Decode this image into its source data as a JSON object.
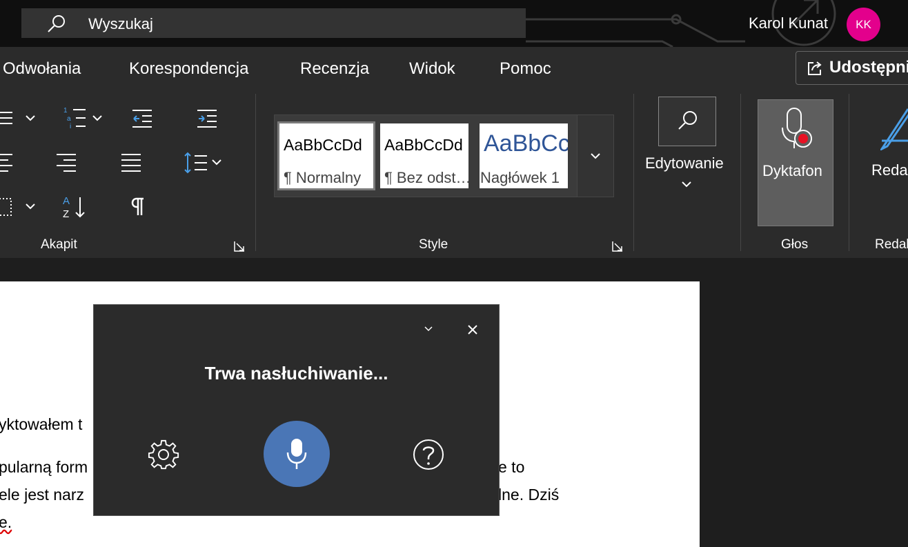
{
  "titlebar": {
    "search_placeholder": "Wyszukaj",
    "user_name": "Karol Kunat",
    "avatar_initials": "KK",
    "avatar_color": "#e3008c"
  },
  "ribbon": {
    "tabs": [
      "Odwołania",
      "Korespondencja",
      "Recenzja",
      "Widok",
      "Pomoc"
    ],
    "share_label": "Udostępnij",
    "groups": {
      "paragraph": "Akapit",
      "styles": "Style",
      "voice": "Głos",
      "editor": "Redaktor"
    },
    "styles": [
      {
        "sample": "AaBbCcDd",
        "name": "¶ Normalny",
        "selected": true
      },
      {
        "sample": "AaBbCcDd",
        "name": "¶ Bez odst…",
        "selected": false
      },
      {
        "sample": "AaBbCc",
        "name": "Nagłówek 1",
        "selected": false
      }
    ],
    "editing_label": "Edytowanie",
    "dictate_label": "Dyktafon",
    "editor_label_partial": "Reda",
    "icons": [
      "bullets-icon",
      "numbering-icon",
      "decrease-indent-icon",
      "increase-indent-icon",
      "align-left-icon",
      "align-right-icon",
      "justify-icon",
      "line-spacing-icon",
      "borders-icon",
      "sort-icon",
      "pilcrow-icon",
      "search-icon",
      "dictate-icon",
      "editor-icon"
    ]
  },
  "document": {
    "lines": [
      "yktowałem t",
      "pularną form",
      "ele jest narz",
      "e.",
      "e to",
      "lne. Dziś"
    ]
  },
  "dictation": {
    "status": "Trwa nasłuchiwanie...",
    "mic_color": "#4a76b6"
  }
}
